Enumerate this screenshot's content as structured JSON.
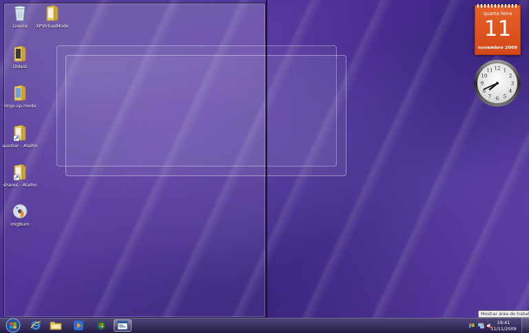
{
  "desktop": {
    "icons": [
      {
        "label": "Lixeira",
        "icon": "recycle-bin-icon"
      },
      {
        "label": "XPVirtualMode",
        "icon": "folder-icon"
      },
      {
        "label": "Oldest",
        "icon": "folder-icon"
      },
      {
        "label": "imgs-xp-mode",
        "icon": "folder-icon"
      },
      {
        "label": "auxiliar - Atalho",
        "icon": "folder-shortcut-icon"
      },
      {
        "label": "shares - Atalho",
        "icon": "folder-shortcut-icon"
      },
      {
        "label": "ImgBurn",
        "icon": "imgburn-icon"
      }
    ]
  },
  "gadgets": {
    "calendar": {
      "weekday": "quarta-feira",
      "day": "11",
      "month_year": "novembro 2009"
    },
    "clock": {
      "hour": 7,
      "minute": 41,
      "numbers": [
        "12",
        "1",
        "2",
        "3",
        "4",
        "5",
        "6",
        "7",
        "8",
        "9",
        "10",
        "11"
      ]
    }
  },
  "taskbar": {
    "pinned": [
      {
        "name": "internet-explorer",
        "icon": "internet-explorer-icon"
      },
      {
        "name": "windows-explorer",
        "icon": "folder-icon"
      },
      {
        "name": "media-player",
        "icon": "media-player-icon"
      },
      {
        "name": "media-center",
        "icon": "media-center-icon"
      },
      {
        "name": "xp-mode-window",
        "icon": "window-icon"
      }
    ],
    "tray": {
      "time": "19:41",
      "date": "11/11/2009",
      "icons": [
        "action-center-flag-icon",
        "network-icon",
        "volume-icon"
      ]
    },
    "show_desktop_tooltip": "Mostrar área de trabalho"
  },
  "colors": {
    "wallpaper": "#3c2480",
    "calendar": "#e05a22",
    "taskbar": "#2d2460"
  }
}
